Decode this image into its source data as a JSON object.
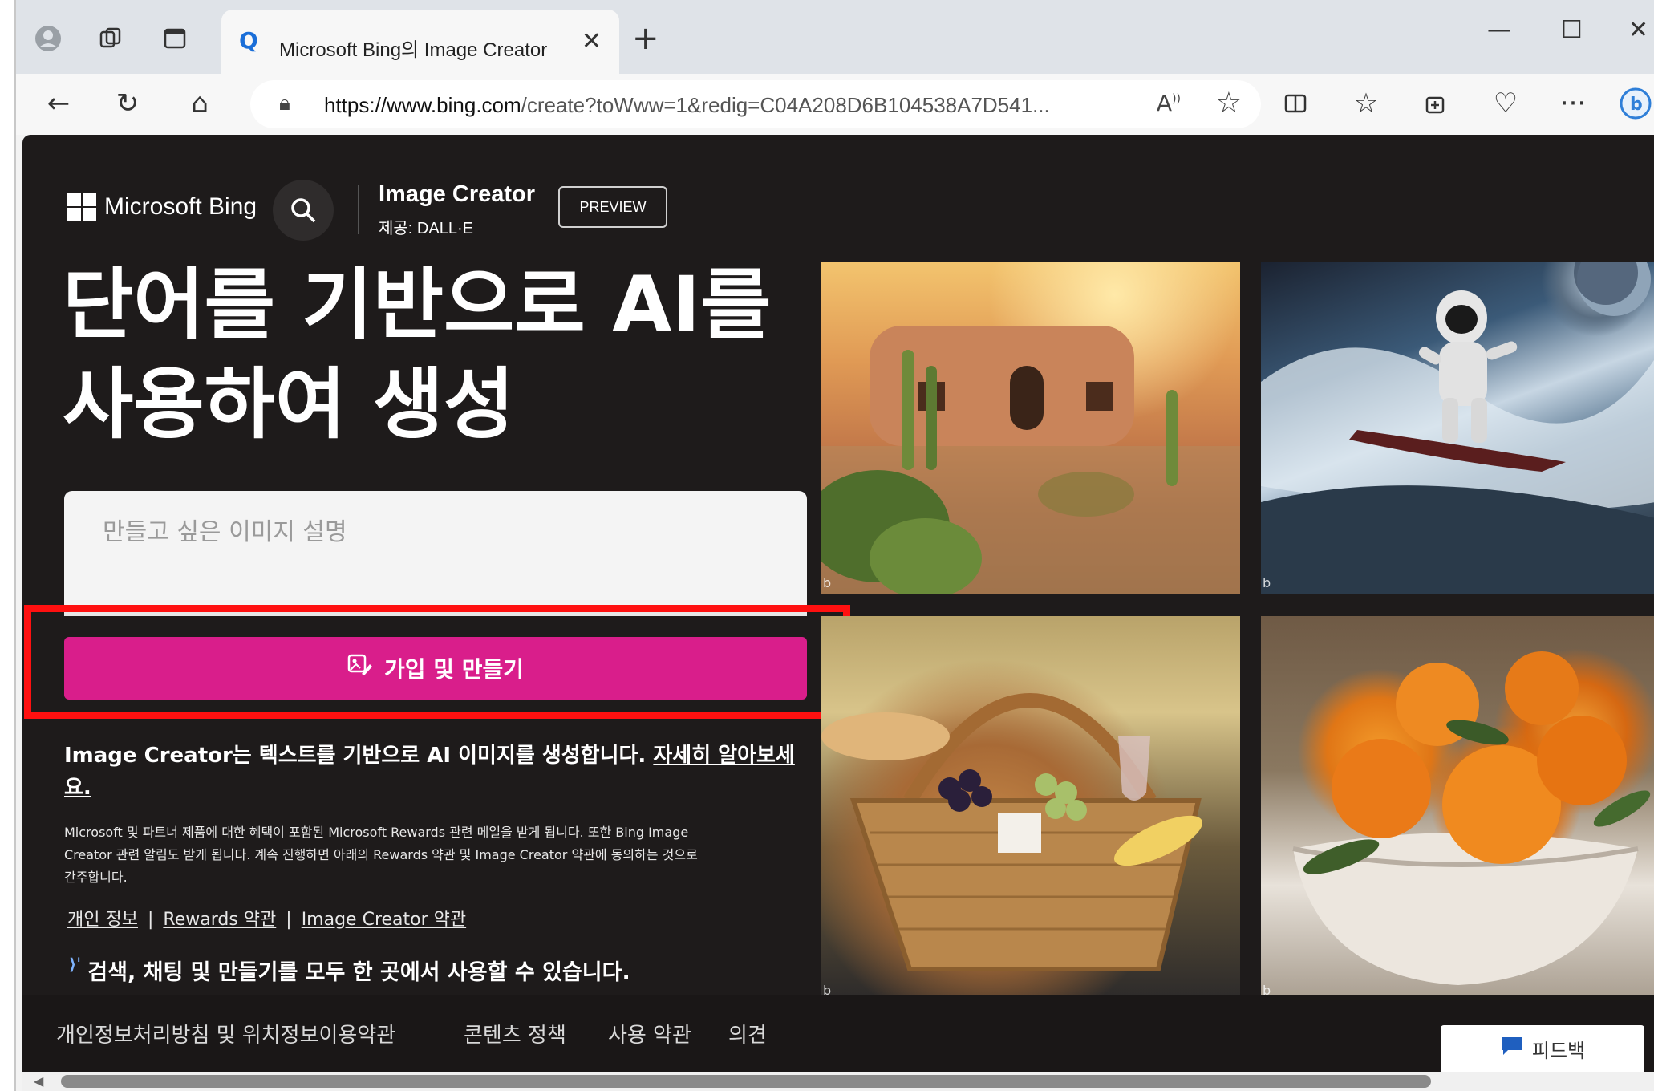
{
  "browser": {
    "tab_title": "Microsoft Bing의 Image Creator",
    "tab_close": "✕",
    "new_tab": "+",
    "url_host": "https://www.bing.com",
    "url_path": "/create?toWww=1&redig=C04A208D6B104538A7D541...",
    "read_aloud": "Â⁾",
    "window_controls": {
      "minimize": "—",
      "maximize": "☐",
      "close": "✕"
    }
  },
  "header": {
    "brand": "Microsoft Bing",
    "app_title": "Image Creator",
    "app_subtitle": "제공: DALL·E",
    "preview_badge": "PREVIEW"
  },
  "hero": {
    "headline_line1": "단어를 기반으로 AI를",
    "headline_line2": "사용하여 생성",
    "prompt_placeholder": "만들고 싶은 이미지 설명",
    "cta_label": "가입 및 만들기"
  },
  "info": {
    "description": "Image Creator는 텍스트를 기반으로 AI 이미지를 생성합니다. ",
    "learn_more": "자세히 알아보세요.",
    "fine_print": "Microsoft 및 파트너 제품에 대한 혜택이 포함된 Microsoft Rewards 관련 메일을 받게 됩니다. 또한 Bing Image Creator 관련 알림도 받게 됩니다. 계속 진행하면 아래의 Rewards 약관 및 Image Creator 약관에 동의하는 것으로 간주합니다.",
    "link_privacy": "개인 정보",
    "link_rewards": "Rewards 약관",
    "link_ic_terms": "Image Creator 약관",
    "separator": "|",
    "tagline": "검색, 채팅 및 만들기를 모두 한 곳에서 사용할 수 있습니다."
  },
  "gallery": [
    {
      "name": "desert-adobe-house-image",
      "mark": "b"
    },
    {
      "name": "astronaut-surfing-image",
      "mark": "b"
    },
    {
      "name": "picnic-basket-image",
      "mark": "b"
    },
    {
      "name": "oranges-bowl-painting-image",
      "mark": "b"
    }
  ],
  "footer": {
    "links": [
      "개인정보처리방침 및 위치정보이용약관",
      "콘텐츠 정책",
      "사용 약관",
      "의견"
    ],
    "feedback": "피드백"
  },
  "colors": {
    "background": "#1e1b1b",
    "cta": "#d91e8b",
    "highlight_box": "#ff1010"
  },
  "icons": [
    "profile-icon",
    "workspaces-icon",
    "tab-actions-icon",
    "search-icon",
    "back-icon",
    "refresh-icon",
    "home-icon",
    "lock-icon",
    "favorite-star-icon",
    "split-screen-icon",
    "favorites-icon",
    "collections-icon",
    "browser-essentials-icon",
    "more-icon",
    "bing-copilot-icon",
    "create-image-icon",
    "feedback-bubble-icon"
  ]
}
